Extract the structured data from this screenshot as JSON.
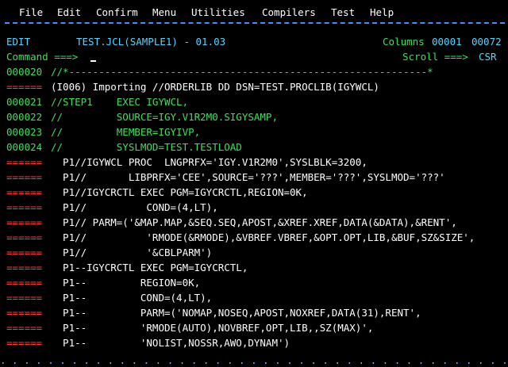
{
  "menu": [
    "File",
    "Edit",
    "Confirm",
    "Menu",
    "Utilities",
    "Compilers",
    "Test",
    "Help"
  ],
  "header": {
    "mode": "EDIT",
    "dataset": "TEST.JCL(SAMPLE1) - 01.03",
    "columns_label": "Columns",
    "col_from": "00001",
    "col_to": "00072",
    "command_label": "Command ===>",
    "command_value": "",
    "scroll_label": "Scroll ===>",
    "scroll_value": "CSR"
  },
  "lines": [
    {
      "num": "000020",
      "text": "//*------------------------------------------------------------*",
      "type": "data"
    },
    {
      "num": "======",
      "text": "(I006) Importing //ORDERLIB DD DSN=TEST.PROCLIB(IGYWCL)",
      "type": "msg"
    },
    {
      "num": "000021",
      "text": "//STEP1    EXEC IGYWCL,",
      "type": "data"
    },
    {
      "num": "000022",
      "text": "//         SOURCE=IGY.V1R2M0.SIGYSAMP,",
      "type": "data"
    },
    {
      "num": "000023",
      "text": "//         MEMBER=IGYIVP,",
      "type": "data"
    },
    {
      "num": "000024",
      "text": "//         SYSLMOD=TEST.TESTLOAD",
      "type": "data"
    },
    {
      "num": "======",
      "text": "  P1//IGYWCL PROC  LNGPRFX='IGY.V1R2M0',SYSLBLK=3200,",
      "type": "expand"
    },
    {
      "num": "======",
      "text": "  P1//       LIBPRFX='CEE',SOURCE='???',MEMBER='???',SYSLMOD='???'",
      "type": "expand"
    },
    {
      "num": "======",
      "text": "  P1//IGYCRCTL EXEC PGM=IGYCRCTL,REGION=0K,",
      "type": "expand"
    },
    {
      "num": "======",
      "text": "  P1//          COND=(4,LT),",
      "type": "expand"
    },
    {
      "num": "======",
      "text": "  P1// PARM=('&MAP.MAP,&SEQ.SEQ,APOST,&XREF.XREF,DATA(&DATA),&RENT',",
      "type": "expand"
    },
    {
      "num": "======",
      "text": "  P1//          'RMODE(&RMODE),&VBREF.VBREF,&OPT.OPT,LIB,&BUF,SZ&SIZE',",
      "type": "expand"
    },
    {
      "num": "======",
      "text": "  P1//          '&CBLPARM')",
      "type": "expand"
    },
    {
      "num": "======",
      "text": "  P1--IGYCRCTL EXEC PGM=IGYCRCTL,",
      "type": "expand"
    },
    {
      "num": "======",
      "text": "  P1--         REGION=0K,",
      "type": "expand"
    },
    {
      "num": "======",
      "text": "  P1--         COND=(4,LT),",
      "type": "expand"
    },
    {
      "num": "======",
      "text": "  P1--         PARM=('NOMAP,NOSEQ,APOST,NOXREF,DATA(31),RENT',",
      "type": "expand"
    },
    {
      "num": "======",
      "text": "  P1--         'RMODE(AUTO),NOVBREF,OPT,LIB,,SZ(MAX)',",
      "type": "expand"
    },
    {
      "num": "======",
      "text": "  P1--         'NOLIST,NOSSR,AWO,DYNAM')",
      "type": "expand"
    }
  ],
  "dots": ". . . . . . . . . . . . . . . . . . . . . . . . . . . . . . . . . . . . . . . . . . . . .",
  "colors": {
    "background": "#000000",
    "cyan": "#59d4ff",
    "green": "#3fe05a",
    "red": "#ff3b3b",
    "white": "#ffffff"
  }
}
